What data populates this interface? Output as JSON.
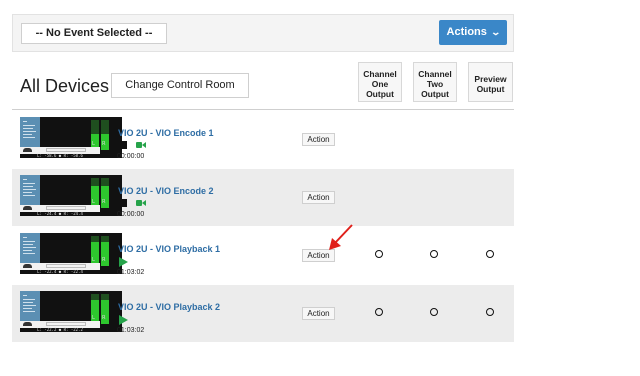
{
  "top_bar": {
    "event_select_label": "-- No Event Selected --",
    "actions_button_label": "Actions"
  },
  "page_title": "All Devices",
  "change_control_room_label": "Change Control Room",
  "columns": {
    "channel_one": [
      "Channel",
      "One",
      "Output"
    ],
    "channel_two": [
      "Channel",
      "Two",
      "Output"
    ],
    "preview": [
      "Preview",
      "Output"
    ]
  },
  "devices": [
    {
      "name": "VIO 2U - VIO Encode 1",
      "controls": "stop-camera",
      "timecode": "00:00:00",
      "action_label": "Action",
      "levels_label": "L: -58.6 ● R: -58.6",
      "meter_level": 0.55,
      "show_outputs": false,
      "alt_background": false
    },
    {
      "name": "VIO 2U - VIO Encode 2",
      "controls": "stop-camera",
      "timecode": "00:00:00",
      "action_label": "Action",
      "levels_label": "L: -24.4 ● R: -24.4",
      "meter_level": 0.75,
      "show_outputs": false,
      "alt_background": true
    },
    {
      "name": "VIO 2U - VIO Playback 1",
      "controls": "play",
      "timecode": "01:03:02",
      "action_label": "Action",
      "levels_label": "L: -22.4 ● R: -22.4",
      "meter_level": 0.8,
      "show_outputs": true,
      "alt_background": false
    },
    {
      "name": "VIO 2U - VIO Playback 2",
      "controls": "play",
      "timecode": "01:03:02",
      "action_label": "Action",
      "levels_label": "L: -22.2 ● R: -22.2",
      "meter_level": 0.8,
      "show_outputs": true,
      "alt_background": true
    }
  ],
  "colors": {
    "accent": "#3a87c8",
    "device_link": "#2e6da4",
    "status_green": "#26a34a",
    "annotation_arrow": "#e0201b"
  },
  "icons": [
    "chevron-down-icon",
    "stop-icon",
    "camera-icon",
    "play-icon",
    "annotation-arrow-icon"
  ]
}
